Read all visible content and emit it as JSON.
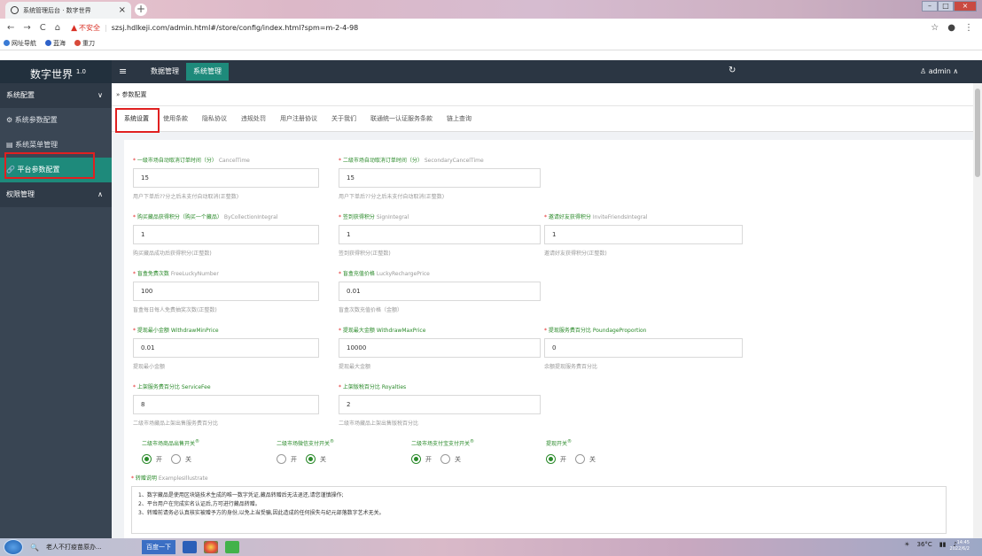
{
  "browser": {
    "tab_title": "系统管理后台 · 数字世界",
    "tab_close": "×",
    "new_tab": "+",
    "insecure_label": "不安全",
    "url": "szsj.hdlkeji.com/admin.html#/store/config/index.html?spm=m-2-4-98",
    "bookmarks": [
      "网址导航",
      "蓝海",
      "重刀"
    ]
  },
  "topbar": {
    "logo": "数字世界",
    "logo_version": "1.0",
    "menu_toggle": "≡",
    "nav": [
      "数据管理",
      "系统管理"
    ],
    "user": "admin"
  },
  "sidebar": {
    "groups": [
      {
        "label": "系统配置",
        "chevron": "∨"
      },
      {
        "label": "权限管理",
        "chevron": "∧"
      }
    ],
    "items": [
      {
        "label": "系统参数配置",
        "icon": "gear-icon"
      },
      {
        "label": "系统菜单管理",
        "icon": "menu-icon"
      },
      {
        "label": "平台参数配置",
        "icon": "link-icon"
      }
    ]
  },
  "breadcrumb": "参数配置",
  "tabs": [
    "系统设置",
    "使用条款",
    "隐私协议",
    "违规处罚",
    "用户注册协议",
    "关于我们",
    "联通统一认证服务条款",
    "链上查询"
  ],
  "fields": [
    {
      "label": "一级市场自动取消订单时间（分）",
      "en": "CancelTime",
      "value": "15",
      "hint": "用户下单后??分之后未支付自动取消(正整数)"
    },
    {
      "label": "二级市场自动取消订单时间（分）",
      "en": "SecondaryCancelTime",
      "value": "15",
      "hint": "用户下单后??分之后未支付自动取消(正整数)"
    },
    {
      "label": "购买藏品获得积分（购买一个藏品）",
      "en": "ByCollectionIntegral",
      "value": "1",
      "hint": "购买藏品成功后获得积分(正整数)"
    },
    {
      "label": "签到获得积分",
      "en": "SignIntegral",
      "value": "1",
      "hint": "签到获得积分(正整数)"
    },
    {
      "label": "邀请好友获得积分",
      "en": "InviteFriendsIntegral",
      "value": "1",
      "hint": "邀请好友获得积分(正整数)"
    },
    {
      "label": "盲盒免费次数",
      "en": "FreeLuckyNumber",
      "value": "100",
      "hint": "盲盒每日每人免费抽奖次数(正整数)"
    },
    {
      "label": "盲盒充值价格",
      "en": "LuckyRechargePrice",
      "value": "0.01",
      "hint": "盲盒次数充值价格（金额）"
    },
    {
      "label": "提现最小金额",
      "en": "WithdrawMinPrice",
      "value": "0.01",
      "hint": "提现最小金额"
    },
    {
      "label": "提现最大金额",
      "en": "WithdrawMaxPrice",
      "value": "10000",
      "hint": "提现最大金额"
    },
    {
      "label": "提现服务费百分比",
      "en": "PoundageProportion",
      "value": "0",
      "hint": "余额提现服务费百分比"
    },
    {
      "label": "上架服务费百分比",
      "en": "ServiceFee",
      "value": "8",
      "hint": "二级市场藏品上架出售服务费百分比"
    },
    {
      "label": "上架版税百分比",
      "en": "Royalties",
      "value": "2",
      "hint": "二级市场藏品上架出售版税百分比"
    }
  ],
  "switches": [
    {
      "label": "二级市场商品出售开关",
      "on": "开",
      "off": "关",
      "selected": "on"
    },
    {
      "label": "二级市场微信支付开关",
      "on": "开",
      "off": "关",
      "selected": "off"
    },
    {
      "label": "二级市场支付宝支付开关",
      "on": "开",
      "off": "关",
      "selected": "on"
    },
    {
      "label": "提现开关",
      "on": "开",
      "off": "关",
      "selected": "on"
    }
  ],
  "switch_mark": "®",
  "illustrate": {
    "label": "转赠说明",
    "en": "ExamplesIllustrate",
    "lines": [
      "1、数字藏品是使用区块链技术生成的唯一数字凭证,藏品转赠后无法退还,请您谨慎操作;",
      "2、平台用户在完成实名认证后,方可进行藏品转赠。",
      "3、转赠前请务必认真核实被赠予方的身份,以免上当受骗,因此造成的任何损失与纪元部落数字艺术无关。"
    ]
  },
  "taskbar": {
    "search": "老人不打疫苗原办...",
    "baidu": "百度一下",
    "temp": "36°C",
    "time": "14:45",
    "date": "2022/6/2"
  },
  "colors": {
    "accent": "#1e8a7b",
    "label_green": "#2a8a2a",
    "highlight_red": "#e02020",
    "topbar": "#2b3643"
  }
}
